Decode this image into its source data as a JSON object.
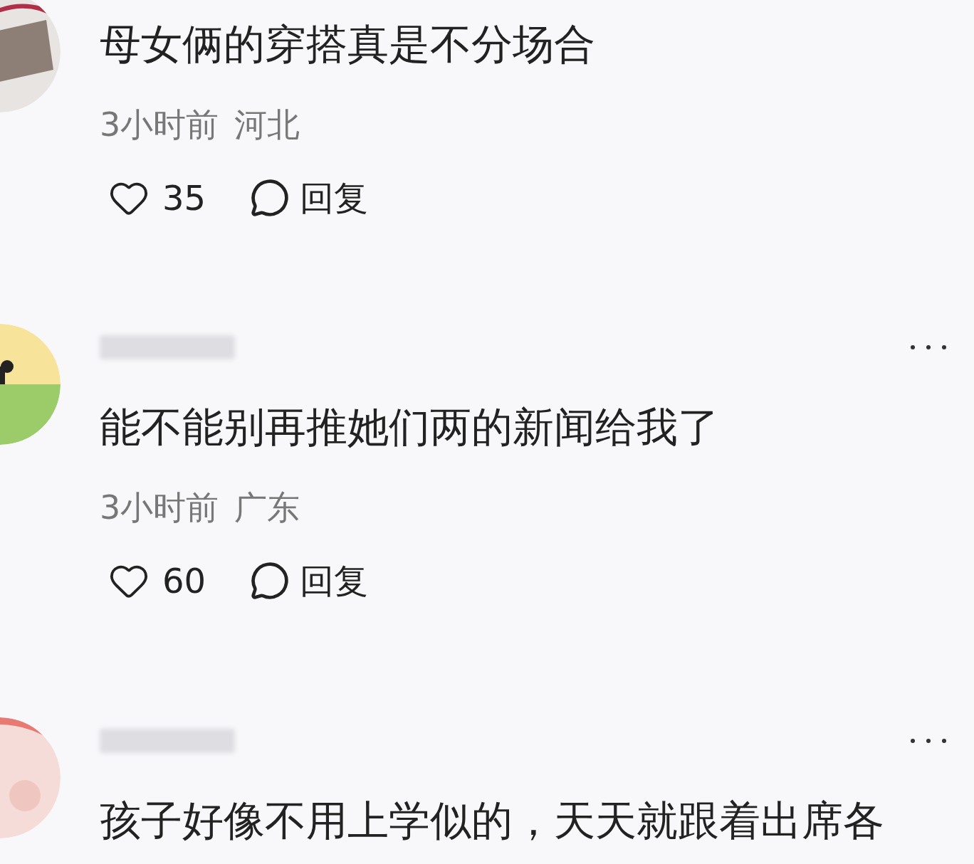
{
  "comments": [
    {
      "name_hidden": false,
      "menu": false,
      "text": "母女俩的穿搭真是不分场合",
      "time": "3小时前",
      "region": "河北",
      "liked": false,
      "likes": "35",
      "reply": "回复"
    },
    {
      "name_hidden": true,
      "menu": true,
      "text": "能不能别再推她们两的新闻给我了",
      "time": "3小时前",
      "region": "广东",
      "liked": false,
      "likes": "60",
      "reply": "回复"
    },
    {
      "name_hidden": true,
      "menu": true,
      "text": "孩子好像不用上学似的，天天就跟着出席各"
    }
  ]
}
